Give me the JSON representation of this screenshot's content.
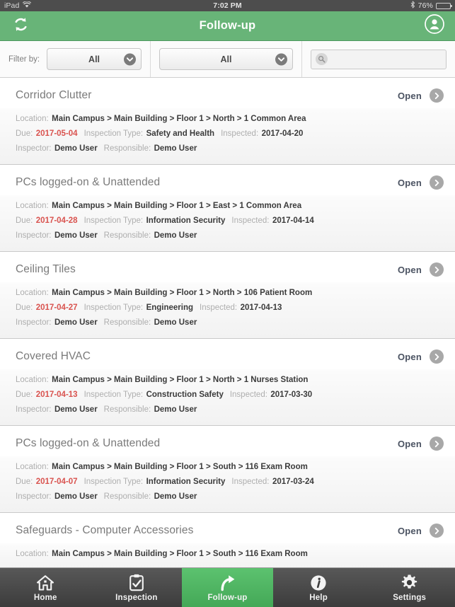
{
  "status_bar": {
    "device": "iPad",
    "wifi_icon": "wifi-icon",
    "time": "7:02 PM",
    "bluetooth_icon": "bluetooth-icon",
    "battery_percent": "76%",
    "battery_level": 76
  },
  "navbar": {
    "refresh_icon": "refresh-icon",
    "title": "Follow-up",
    "account_icon": "account-icon",
    "background_color": "#68b478"
  },
  "filter_bar": {
    "label": "Filter by:",
    "filter_one": {
      "value": "All",
      "options": [
        "All"
      ]
    },
    "filter_two": {
      "value": "All",
      "options": [
        "All"
      ]
    },
    "search": {
      "value": "",
      "placeholder": "",
      "icon": "search-icon"
    }
  },
  "list": {
    "open_label": "Open",
    "chevron_icon": "chevron-right-icon",
    "labels": {
      "location": "Location:",
      "due": "Due:",
      "inspection_type": "Inspection Type:",
      "inspected": "Inspected:",
      "inspector": "Inspector:",
      "responsible": "Responsible:"
    },
    "due_color": "#d9534f",
    "items": [
      {
        "title": "Corridor Clutter",
        "location": "Main Campus > Main Building > Floor 1 > North > 1 Common Area",
        "due": "2017-05-04",
        "inspection_type": "Safety and Health",
        "inspected": "2017-04-20",
        "inspector": "Demo User",
        "responsible": "Demo User"
      },
      {
        "title": "PCs logged-on & Unattended",
        "location": "Main Campus > Main Building > Floor 1 > East > 1 Common Area",
        "due": "2017-04-28",
        "inspection_type": "Information Security",
        "inspected": "2017-04-14",
        "inspector": "Demo User",
        "responsible": "Demo User"
      },
      {
        "title": "Ceiling Tiles",
        "location": "Main Campus > Main Building > Floor 1 > North > 106 Patient Room",
        "due": "2017-04-27",
        "inspection_type": "Engineering",
        "inspected": "2017-04-13",
        "inspector": "Demo User",
        "responsible": "Demo User"
      },
      {
        "title": "Covered HVAC",
        "location": "Main Campus > Main Building > Floor 1 > North > 1 Nurses Station",
        "due": "2017-04-13",
        "inspection_type": "Construction Safety",
        "inspected": "2017-03-30",
        "inspector": "Demo User",
        "responsible": "Demo User"
      },
      {
        "title": "PCs logged-on & Unattended",
        "location": "Main Campus > Main Building > Floor 1 > South > 116 Exam Room",
        "due": "2017-04-07",
        "inspection_type": "Information Security",
        "inspected": "2017-03-24",
        "inspector": "Demo User",
        "responsible": "Demo User"
      },
      {
        "title": "Safeguards - Computer Accessories",
        "location": "Main Campus > Main Building > Floor 1 > South > 116 Exam Room",
        "due": "",
        "inspection_type": "",
        "inspected": "",
        "inspector": "",
        "responsible": ""
      }
    ]
  },
  "tabbar": {
    "active_color": "#5cc26f",
    "tabs": [
      {
        "label": "Home",
        "icon": "home-icon",
        "active": false
      },
      {
        "label": "Inspection",
        "icon": "clipboard-check-icon",
        "active": false
      },
      {
        "label": "Follow-up",
        "icon": "arrow-curve-right-icon",
        "active": true
      },
      {
        "label": "Help",
        "icon": "info-circle-icon",
        "active": false
      },
      {
        "label": "Settings",
        "icon": "gear-icon",
        "active": false
      }
    ]
  }
}
